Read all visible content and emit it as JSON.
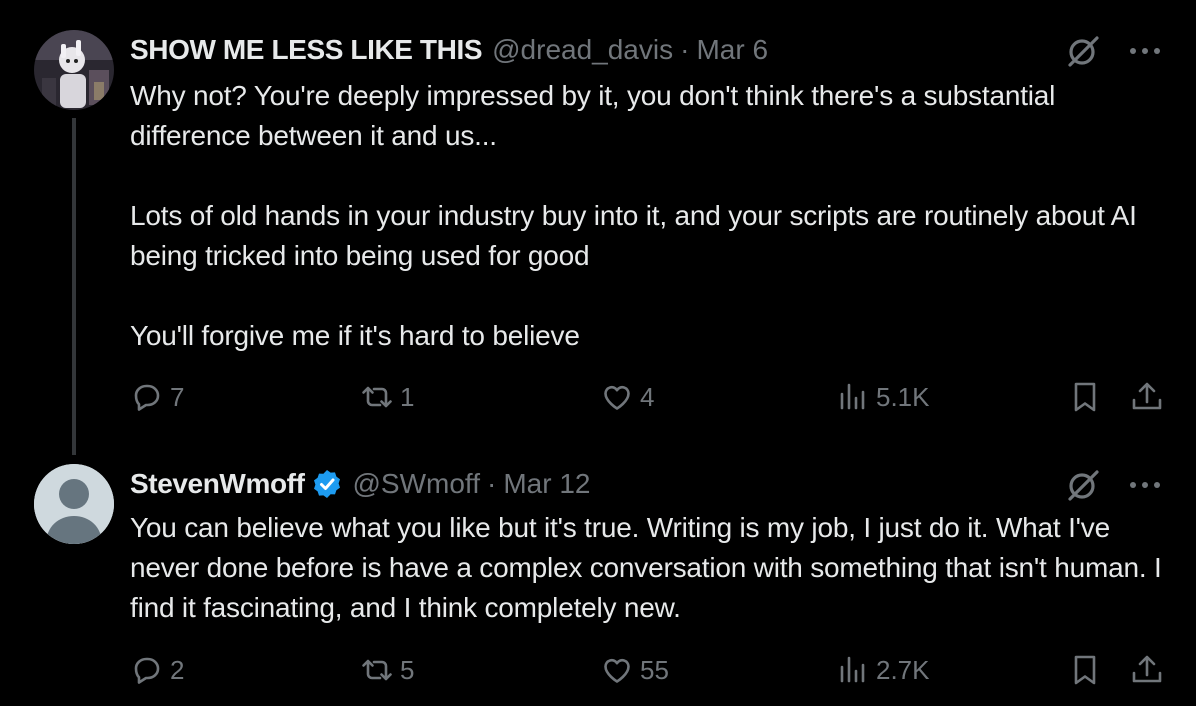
{
  "colors": {
    "background": "#000000",
    "text_primary": "#e7e9ea",
    "text_secondary": "#71767b",
    "verified_blue": "#1d9bf0",
    "thread_line": "#333639"
  },
  "tweets": [
    {
      "display_name": "SHOW ME LESS LIKE THIS",
      "handle": "@dread_davis",
      "separator": "·",
      "date": "Mar 6",
      "verified": false,
      "avatar_icon": "profile-photo",
      "paragraphs": [
        "Why not? You're deeply impressed by it, you don't think there's a substantial difference between it and us...",
        "Lots of old hands in your industry buy into it, and your scripts are routinely about AI being tricked into being used for good",
        "You'll forgive me if it's hard to believe"
      ],
      "stats": {
        "replies": "7",
        "reposts": "1",
        "likes": "4",
        "views": "5.1K"
      }
    },
    {
      "display_name": "StevenWmoff",
      "handle": "@SWmoff",
      "separator": "·",
      "date": "Mar 12",
      "verified": true,
      "avatar_icon": "default-avatar",
      "paragraphs": [
        "You can believe what you like but it's true. Writing is my job, I just do it. What I've never done before is have a complex conversation with something that isn't human. I find it fascinating, and I think completely new."
      ],
      "stats": {
        "replies": "2",
        "reposts": "5",
        "likes": "55",
        "views": "2.7K"
      }
    }
  ],
  "icons": {
    "grok": "grok-slash-icon",
    "more": "more-icon",
    "reply": "reply-icon",
    "repost": "repost-icon",
    "like": "heart-icon",
    "views": "views-icon",
    "bookmark": "bookmark-icon",
    "share": "share-icon"
  }
}
